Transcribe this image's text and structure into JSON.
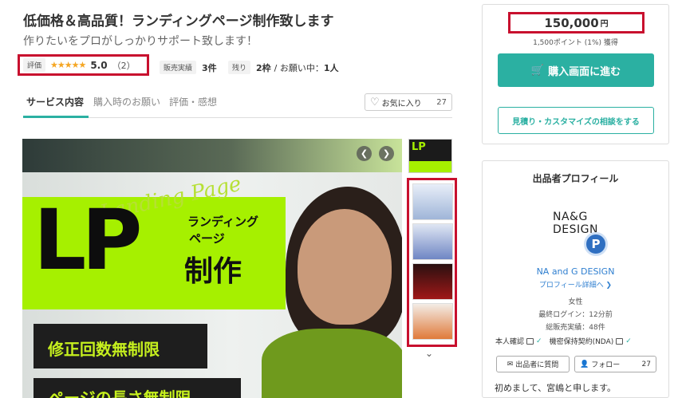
{
  "header": {
    "title": "低価格＆高品質！ランディングページ制作致します",
    "subtitle": "作りたいをプロがしっかりサポート致します！"
  },
  "rating": {
    "label": "評価",
    "stars": "★★★★★",
    "score": "5.0",
    "count": "（2）"
  },
  "meta": {
    "sales_label": "販売実績",
    "sales_value": "3件",
    "remaining_label": "残り",
    "remaining_value": "2枠",
    "inprogress_text": "/ お願い中：",
    "inprogress_value": "1人"
  },
  "tabs": [
    {
      "label": "サービス内容"
    },
    {
      "label": "購入時のお願い"
    },
    {
      "label": "評価・感想"
    }
  ],
  "favorite": {
    "label": "お気に入り",
    "count": "27"
  },
  "hero": {
    "script_text": "Landing Page",
    "lp_text": "LP",
    "side_line1": "ランディング",
    "side_line2": "ページ",
    "side_line3": "制作",
    "banner1": "修正回数無制限",
    "banner2": "ページの長さ無制限",
    "prev_icon": "chevron-left-icon",
    "next_icon": "chevron-right-icon"
  },
  "thumbnails": {
    "main_label": "LP",
    "more_icon": "chevron-down-icon"
  },
  "purchase": {
    "price": "150,000",
    "currency": "円",
    "points": "1,500ポイント (1%) 獲得",
    "buy_label": "購入画面に進む",
    "consult_label": "見積り・カスタマイズの相談をする"
  },
  "profile": {
    "title": "出品者プロフィール",
    "logo_line1": "NA&G",
    "logo_line2": "DESIGN",
    "badge": "P",
    "name": "NA and G DESIGN",
    "link": "プロフィール詳細へ ❯",
    "gender": "女性",
    "last_login": "最終ログイン：12分前",
    "total_sales": "総販売実績：48件",
    "identity_label": "本人確認",
    "nda_label": "機密保持契約(NDA)",
    "question_label": "出品者に質問",
    "follow_label": "フォロー",
    "follow_count": "27",
    "greeting": "初めまして、宮嶋と申します。"
  },
  "colors": {
    "accent": "#2bb0a2",
    "highlight_border": "#c8102e",
    "lime": "#a6f000"
  }
}
